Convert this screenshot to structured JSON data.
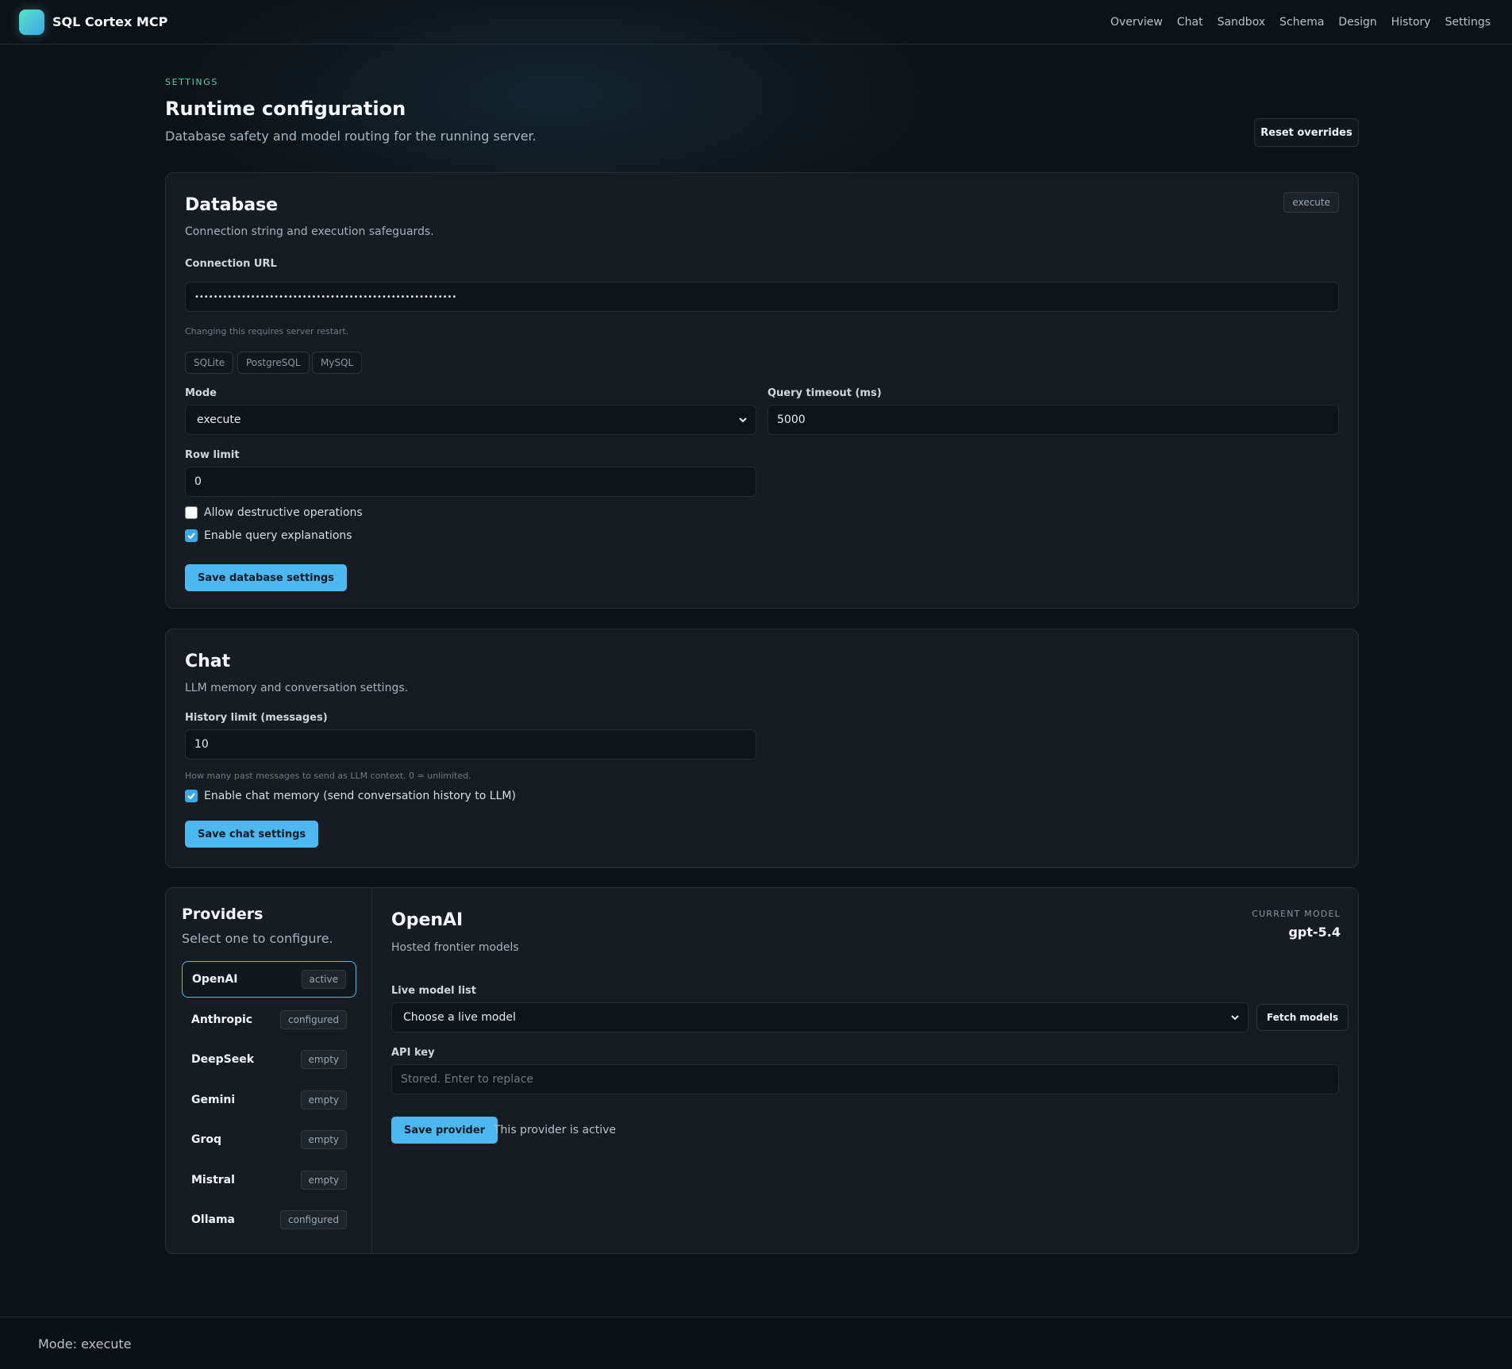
{
  "brand": {
    "name": "SQL Cortex MCP"
  },
  "nav": [
    "Overview",
    "Chat",
    "Sandbox",
    "Schema",
    "Design",
    "History",
    "Settings"
  ],
  "header": {
    "eyebrow": "SETTINGS",
    "title": "Runtime configuration",
    "subtitle": "Database safety and model routing for the running server.",
    "reset_label": "Reset overrides"
  },
  "database": {
    "title": "Database",
    "subtitle": "Connection string and execution safeguards.",
    "mode_badge": "execute",
    "connection_label": "Connection URL",
    "connection_value": "••••••••••••••••••••••••••••••••••••••••••••••••••••••••",
    "connection_hint": "Changing this requires server restart.",
    "presets": [
      "SQLite",
      "PostgreSQL",
      "MySQL"
    ],
    "mode_label": "Mode",
    "mode_value": "execute",
    "timeout_label": "Query timeout (ms)",
    "timeout_value": "5000",
    "row_limit_label": "Row limit",
    "row_limit_value": "0",
    "allow_destructive_label": "Allow destructive operations",
    "allow_destructive": false,
    "explanations_label": "Enable query explanations",
    "explanations": true,
    "save_label": "Save database settings"
  },
  "chat": {
    "title": "Chat",
    "subtitle": "LLM memory and conversation settings.",
    "history_label": "History limit (messages)",
    "history_value": "10",
    "history_hint": "How many past messages to send as LLM context. 0 = unlimited.",
    "memory_label": "Enable chat memory (send conversation history to LLM)",
    "memory": true,
    "save_label": "Save chat settings"
  },
  "providers": {
    "title": "Providers",
    "subtitle": "Select one to configure.",
    "items": [
      {
        "name": "OpenAI",
        "status": "active"
      },
      {
        "name": "Anthropic",
        "status": "configured"
      },
      {
        "name": "DeepSeek",
        "status": "empty"
      },
      {
        "name": "Gemini",
        "status": "empty"
      },
      {
        "name": "Groq",
        "status": "empty"
      },
      {
        "name": "Mistral",
        "status": "empty"
      },
      {
        "name": "Ollama",
        "status": "configured"
      }
    ],
    "selected": {
      "name": "OpenAI",
      "description": "Hosted frontier models",
      "current_model_label": "CURRENT MODEL",
      "current_model": "gpt-5.4",
      "model_list_label": "Live model list",
      "model_list_value": "Choose a live model",
      "fetch_label": "Fetch models",
      "api_key_label": "API key",
      "api_key_placeholder": "Stored. Enter to replace",
      "save_label": "Save provider",
      "status_text": "This provider is active"
    }
  },
  "footer": {
    "mode_text": "Mode: execute"
  },
  "colors": {
    "accent": "#4cb8f0",
    "eyebrow": "#4fd1a5",
    "background": "#0d1216"
  }
}
